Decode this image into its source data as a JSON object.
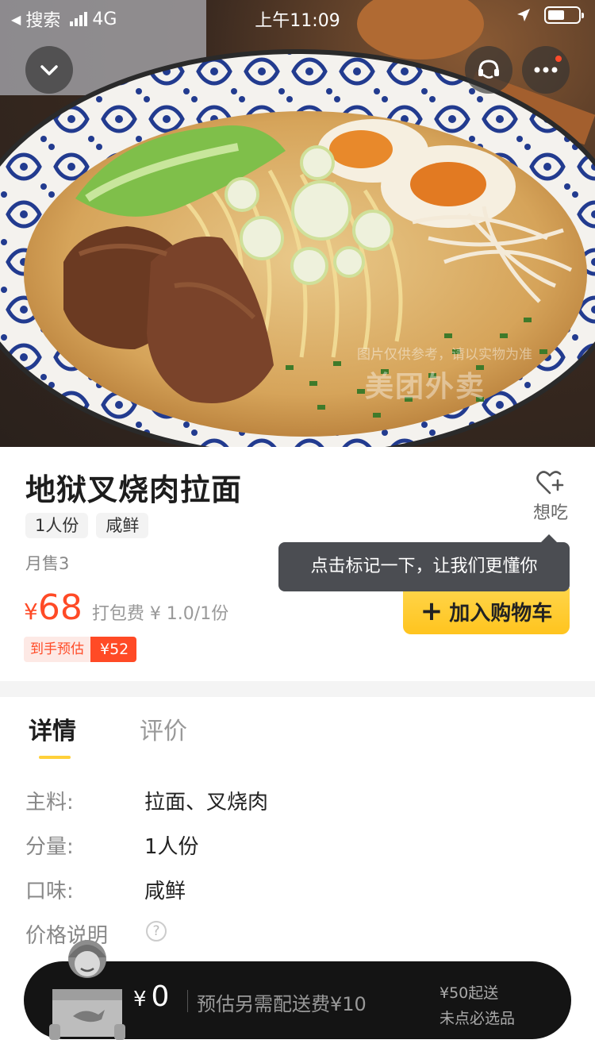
{
  "status_bar": {
    "back_label": "搜索",
    "network": "4G",
    "time": "上午11:09",
    "battery_level": 0.55
  },
  "hero": {
    "watermark": "图片仅供参考，请以实物为准",
    "brand_watermark": "美团外卖"
  },
  "product": {
    "name": "地狱叉烧肉拉面",
    "tags": [
      "1人份",
      "咸鲜"
    ],
    "monthly_sales": "月售3",
    "price_symbol": "¥",
    "price": "68",
    "packing_fee": "打包费 ¥ 1.0/1份",
    "estimate_label": "到手预估",
    "estimate_value": "¥52",
    "want_label": "想吃",
    "tooltip": "点击标记一下，让我们更懂你",
    "add_to_cart": "加入购物车"
  },
  "tabs": [
    "详情",
    "评价"
  ],
  "details": [
    {
      "key": "主料:",
      "value": "拉面、叉烧肉"
    },
    {
      "key": "分量:",
      "value": "1人份"
    },
    {
      "key": "口味:",
      "value": "咸鲜"
    },
    {
      "key": "价格说明",
      "value": "?"
    }
  ],
  "cart": {
    "symbol": "¥",
    "total": "0",
    "delivery_note": "预估另需配送费¥10",
    "min_order": "¥50起送",
    "required_note": "未点必选品"
  },
  "colors": {
    "accent_yellow": "#ffc41e",
    "price_red": "#ff4a26",
    "cart_bg": "#141414"
  }
}
